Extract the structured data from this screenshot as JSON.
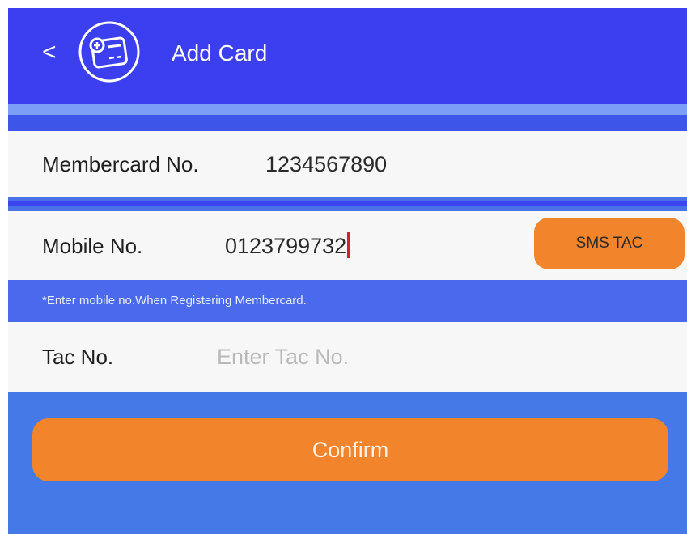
{
  "header": {
    "back_label": "<",
    "title": "Add Card",
    "icon": "add-card-icon"
  },
  "form": {
    "membercard": {
      "label": "Membercard No.",
      "value": "1234567890"
    },
    "mobile": {
      "label": "Mobile No.",
      "value": "0123799732"
    },
    "sms_button_label": "SMS TAC",
    "hint": "*Enter mobile no.When Registering Membercard.",
    "tac": {
      "label": "Tac No.",
      "placeholder": "Enter Tac No."
    }
  },
  "confirm_label": "Confirm",
  "colors": {
    "header": "#3c3ff0",
    "background": "#4679e8",
    "accent": "#f2842c",
    "caret": "#d0242a"
  }
}
